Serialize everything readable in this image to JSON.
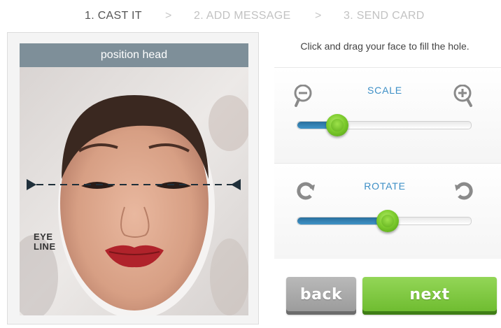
{
  "steps": [
    {
      "label": "1. CAST IT",
      "active": true
    },
    {
      "label": "2. ADD MESSAGE",
      "active": false
    },
    {
      "label": "3. SEND CARD",
      "active": false
    }
  ],
  "step_separator": ">",
  "photo": {
    "header": "position head",
    "eye_line_label": [
      "EYE",
      "LINE"
    ]
  },
  "instruction": "Click and drag your face to fill the hole.",
  "scale": {
    "label": "SCALE",
    "value_fraction": 0.23,
    "minus_icon": "zoom-out-icon",
    "plus_icon": "zoom-in-icon"
  },
  "rotate": {
    "label": "ROTATE",
    "value_fraction": 0.52,
    "left_icon": "rotate-left-icon",
    "right_icon": "rotate-right-icon"
  },
  "buttons": {
    "back": "back",
    "next": "next"
  },
  "colors": {
    "accent_blue": "#3d8fc6",
    "slider_fill": "#2f7fb4",
    "knob_green": "#7fcd2f",
    "next_green": "#7cc43f",
    "back_gray": "#a8a8a8",
    "photo_bar": "#7e8f99"
  }
}
